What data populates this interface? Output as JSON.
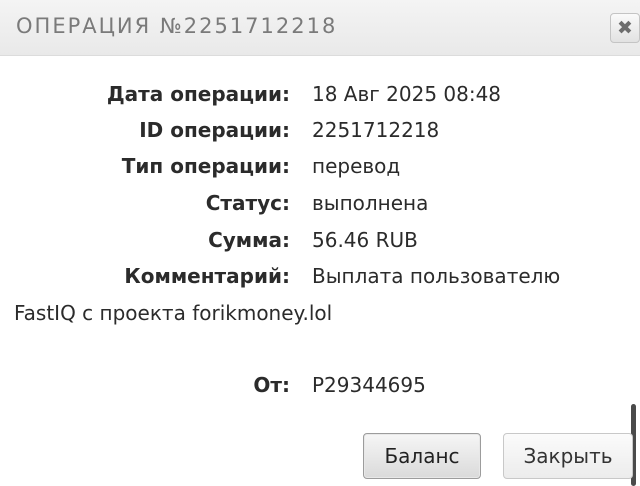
{
  "dialog": {
    "title": "ОПЕРАЦИЯ №2251712218",
    "close_glyph": "✖"
  },
  "fields": [
    {
      "label": "Дата операции:",
      "value": "18 Авг 2025 08:48"
    },
    {
      "label": "ID операции:",
      "value": "2251712218"
    },
    {
      "label": "Тип операции:",
      "value": "перевод"
    },
    {
      "label": "Статус:",
      "value": "выполнена"
    },
    {
      "label": "Сумма:",
      "value": "56.46 RUB"
    },
    {
      "label": "Комментарий:",
      "value": "Выплата пользователю"
    }
  ],
  "comment_continuation": "FastIQ с проекта forikmoney.lol",
  "from": {
    "label": "От:",
    "value": "P29344695"
  },
  "buttons": {
    "balance": "Баланс",
    "close": "Закрыть"
  }
}
